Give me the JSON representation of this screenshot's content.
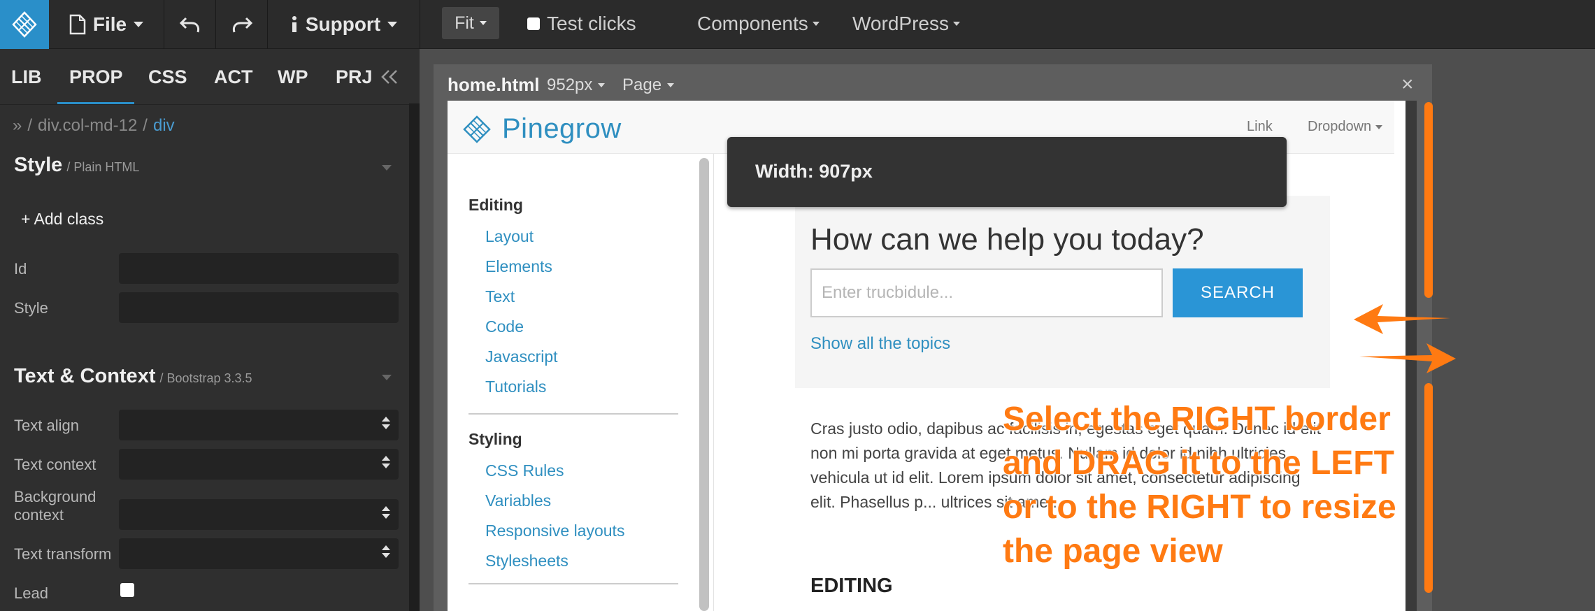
{
  "toolbar": {
    "file_label": "File",
    "support_label": "Support",
    "fit_label": "Fit",
    "test_clicks_label": "Test clicks",
    "components_label": "Components",
    "wordpress_label": "WordPress"
  },
  "panel_tabs": [
    "LIB",
    "PROP",
    "CSS",
    "ACT",
    "WP",
    "PRJ"
  ],
  "breadcrumb": {
    "sep_icon": "»",
    "slash": "/",
    "parent": "div.col-md-12",
    "current": "div"
  },
  "style_section": {
    "title": "Style",
    "subtitle": "/ Plain HTML",
    "add_class_label": "+ Add class",
    "id_label": "Id",
    "style_label": "Style"
  },
  "text_section": {
    "title": "Text & Context",
    "subtitle": "/ Bootstrap 3.3.5",
    "text_align_label": "Text align",
    "text_context_label": "Text context",
    "background_context_label": "Background context",
    "text_transform_label": "Text transform",
    "lead_label": "Lead"
  },
  "frame": {
    "file_name": "home.html",
    "width_label": "952px",
    "page_label": "Page",
    "close_glyph": "×"
  },
  "tooltip": {
    "text": "Width: 907px"
  },
  "site": {
    "brand_name": "Pinegrow",
    "nav_link": "Link",
    "nav_dropdown": "Dropdown",
    "sidebar": {
      "editing_head": "Editing",
      "editing_items": [
        "Layout",
        "Elements",
        "Text",
        "Code",
        "Javascript",
        "Tutorials"
      ],
      "styling_head": "Styling",
      "styling_items": [
        "CSS Rules",
        "Variables",
        "Responsive layouts",
        "Stylesheets"
      ]
    },
    "help": {
      "title": "How can we help you today?",
      "placeholder": "Enter trucbidule...",
      "button": "SEARCH",
      "link": "Show all the topics"
    },
    "body_text": "Cras justo odio, dapibus ac facilisis in, egestas eget quam. Donec id elit non mi porta gravida at eget metus. Nullam id dolor id nibh ultricies vehicula ut id elit. Lorem ipsum dolor sit amet, consectetur adipiscing elit. Phasellus p... ultrices sit amet.",
    "section_head": "EDITING"
  },
  "annotation": {
    "line1": "Select the RIGHT border",
    "line2": "and DRAG it to the LEFT",
    "line3": "or to the RIGHT to resize",
    "line4": "the page view",
    "color": "#ff7a12"
  },
  "colors": {
    "accent": "#2a8fc9",
    "link": "#2f8fc0",
    "annotation": "#ff7a12"
  }
}
